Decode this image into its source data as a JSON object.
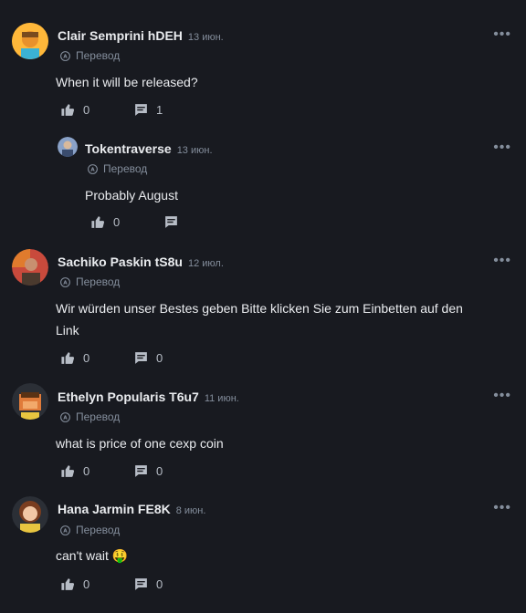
{
  "comments": [
    {
      "name": "Clair Semprini hDEH",
      "date": "13 июн.",
      "translate": "Перевод",
      "text": "When it will be released?",
      "likes": "0",
      "replies": "1"
    },
    {
      "name": "Tokentraverse",
      "date": "13 июн.",
      "translate": "Перевод",
      "text": "Probably August",
      "likes": "0",
      "replies": ""
    },
    {
      "name": "Sachiko Paskin tS8u",
      "date": "12 июл.",
      "translate": "Перевод",
      "text": "Wir würden unser Bestes geben Bitte klicken Sie zum Einbetten auf den Link",
      "likes": "0",
      "replies": "0"
    },
    {
      "name": "Ethelyn Popularis T6u7",
      "date": "11 июн.",
      "translate": "Перевод",
      "text": "what is price of one cexp coin",
      "likes": "0",
      "replies": "0"
    },
    {
      "name": "Hana Jarmin FE8K",
      "date": "8 июн.",
      "translate": "Перевод",
      "text": "can't wait 🤑",
      "likes": "0",
      "replies": "0"
    }
  ],
  "more_label": "•••",
  "colors": {
    "bg": "#181a20",
    "text": "#eaecef",
    "muted": "#848e9c"
  },
  "icons": {
    "like": "thumbs-up-icon",
    "reply": "comment-icon",
    "translate": "translate-icon",
    "more": "more-icon"
  }
}
